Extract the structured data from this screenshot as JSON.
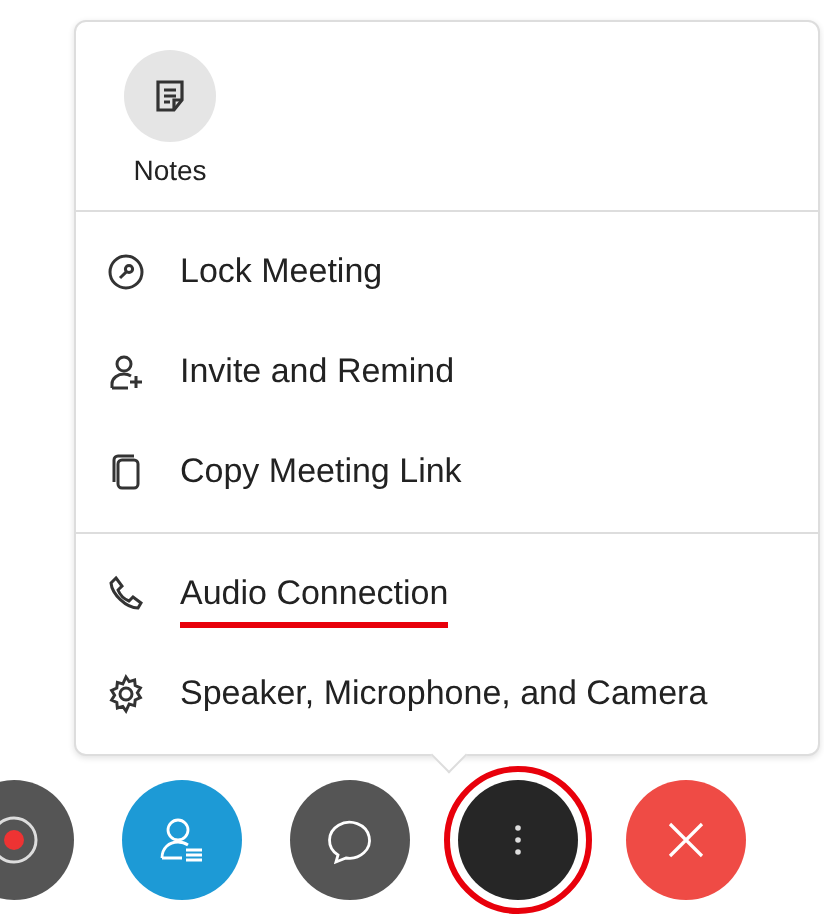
{
  "menu": {
    "top_actions": [
      {
        "label": "Notes",
        "kind": "notes"
      }
    ],
    "groups": [
      [
        {
          "label": "Lock Meeting",
          "kind": "lock",
          "highlighted": false
        },
        {
          "label": "Invite and Remind",
          "kind": "invite",
          "highlighted": false
        },
        {
          "label": "Copy Meeting Link",
          "kind": "copy",
          "highlighted": false
        }
      ],
      [
        {
          "label": "Audio Connection",
          "kind": "audio",
          "highlighted": true
        },
        {
          "label": "Speaker, Microphone, and Camera",
          "kind": "settings",
          "highlighted": false
        }
      ]
    ]
  },
  "toolbar": [
    {
      "kind": "record",
      "highlighted": false
    },
    {
      "kind": "participants",
      "highlighted": false
    },
    {
      "kind": "chat",
      "highlighted": false
    },
    {
      "kind": "more",
      "highlighted": true
    },
    {
      "kind": "end",
      "highlighted": false
    }
  ]
}
